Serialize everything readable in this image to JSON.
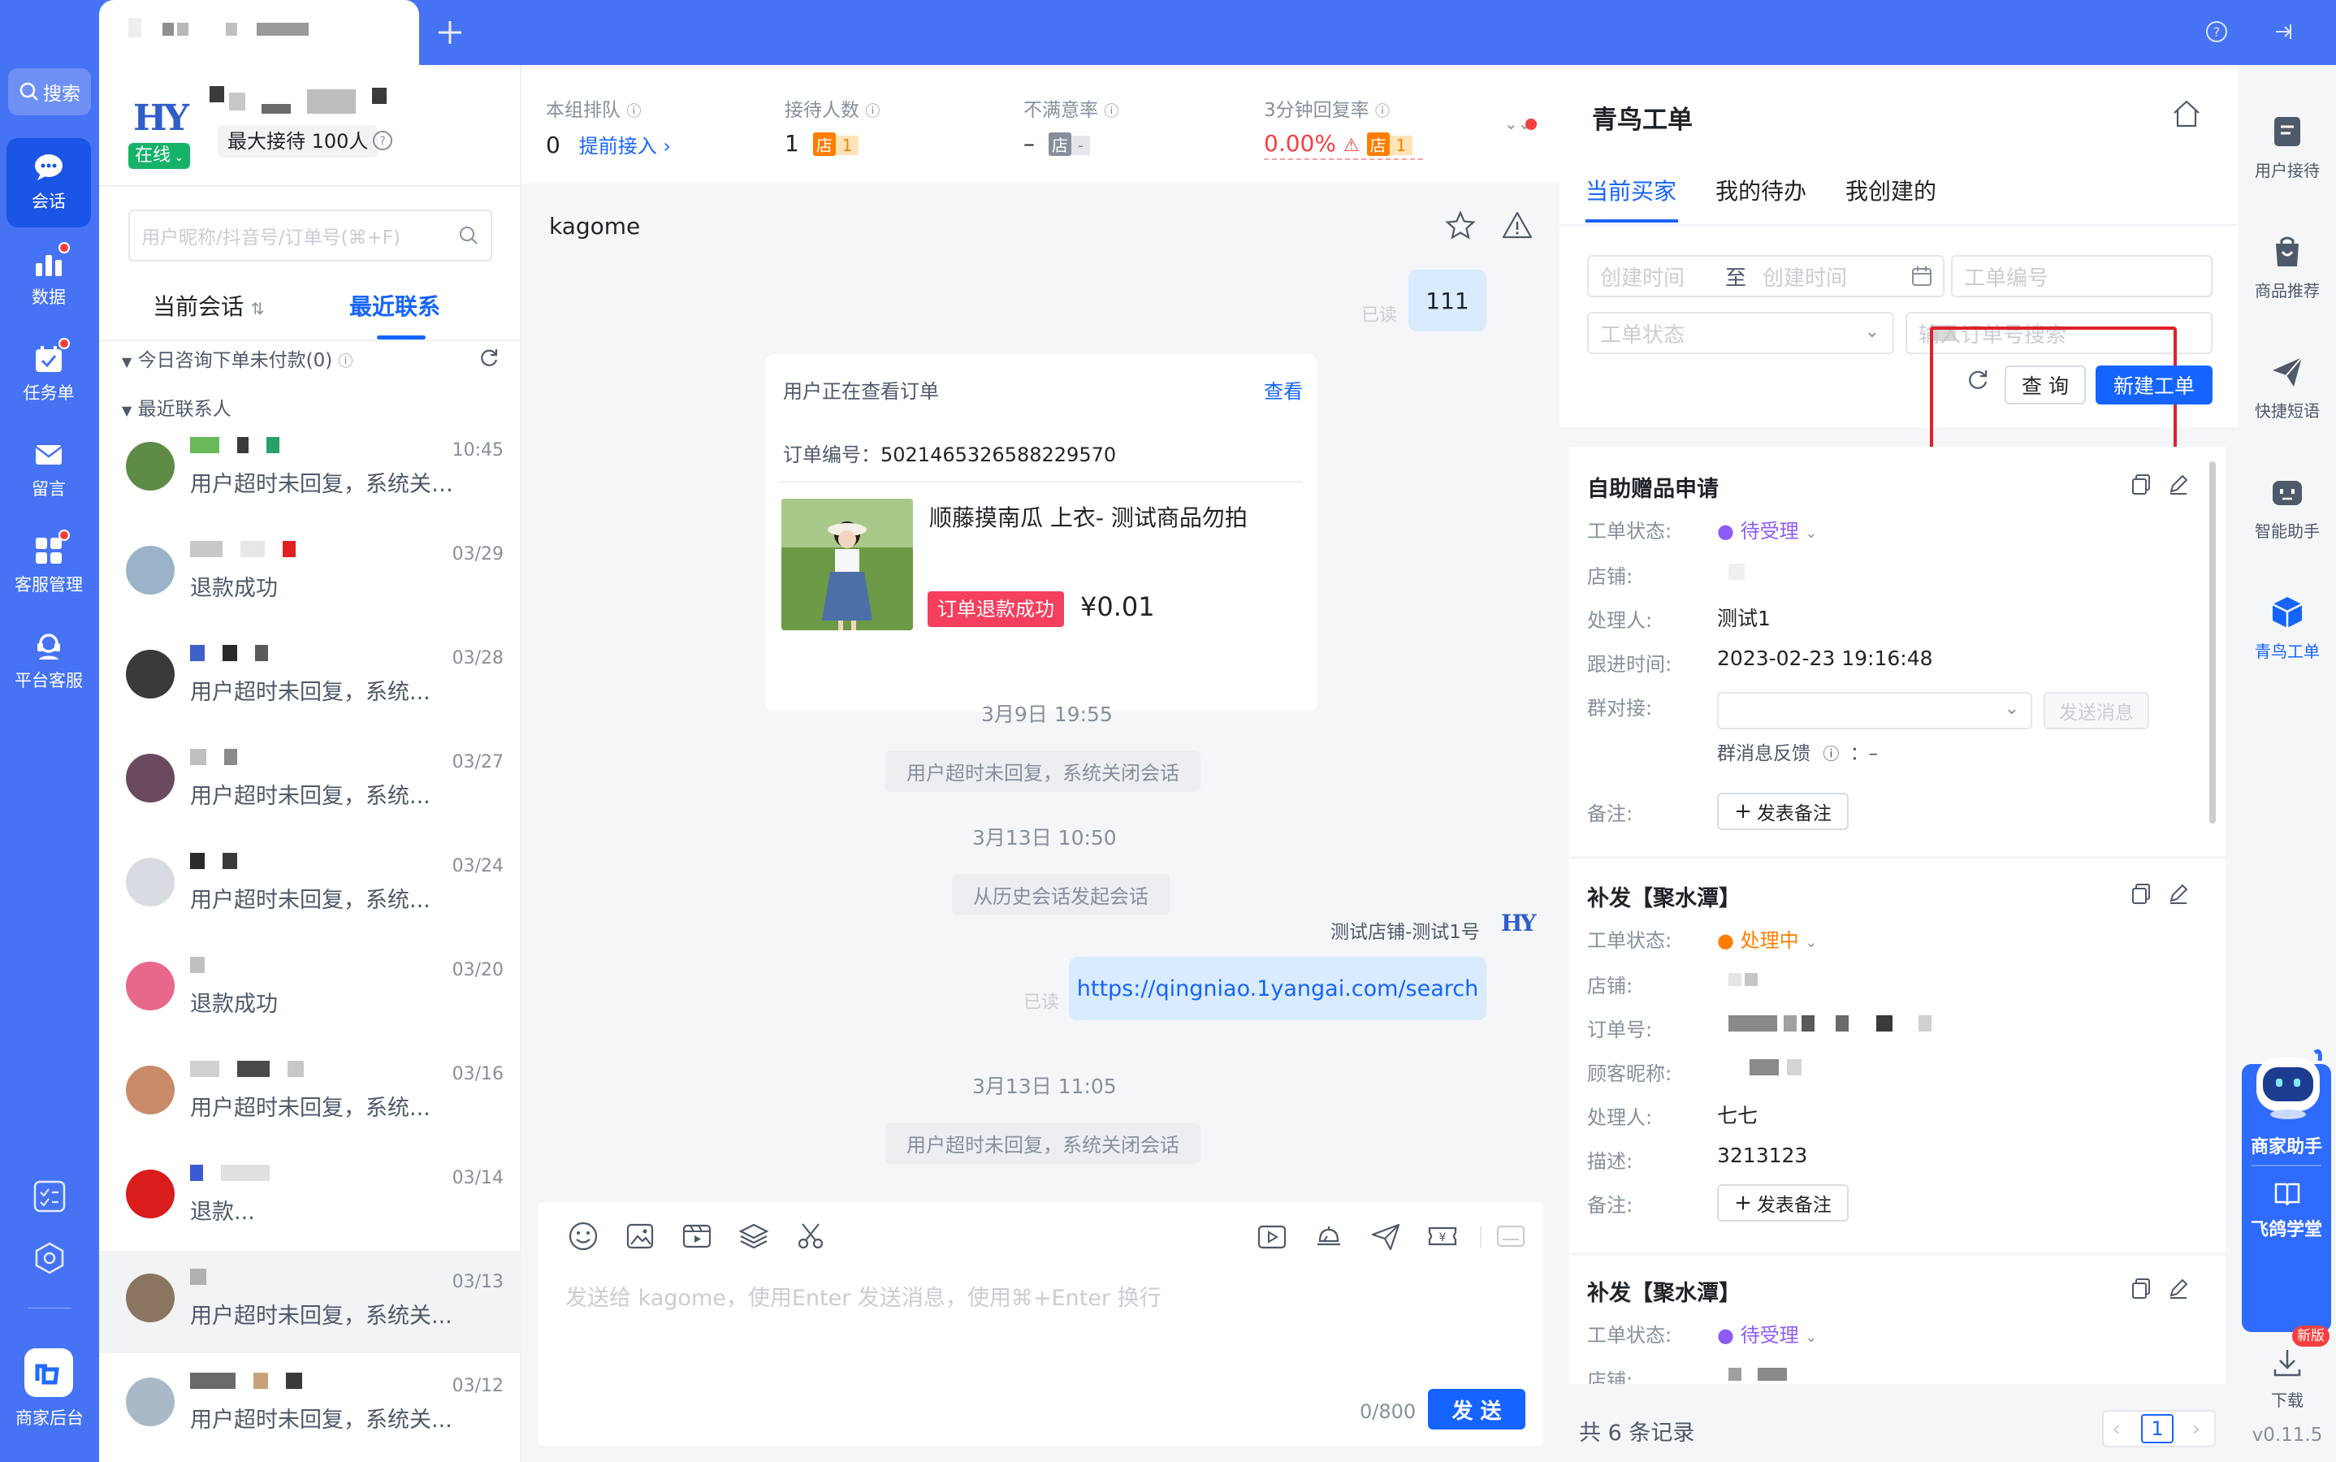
{
  "search": {
    "label": "搜索"
  },
  "nav": [
    {
      "label": "会话",
      "icon": "chat-icon",
      "active": true
    },
    {
      "label": "数据",
      "icon": "chart-icon",
      "badge": true
    },
    {
      "label": "任务单",
      "icon": "calendar-check-icon",
      "badge": true
    },
    {
      "label": "留言",
      "icon": "mail-icon"
    },
    {
      "label": "客服管理",
      "icon": "grid-icon",
      "badge": true
    },
    {
      "label": "平台客服",
      "icon": "headset-icon"
    }
  ],
  "nav_bottom": {
    "backend_label": "商家后台"
  },
  "agent": {
    "status": "在线",
    "max_receive": "最大接待 100人",
    "logo_text": "HY"
  },
  "contact_search": {
    "placeholder": "用户昵称/抖音号/订单号(⌘+F)"
  },
  "contact_tabs": {
    "current": "当前会话",
    "recent": "最近联系"
  },
  "sections": {
    "today_unpaid": "今日咨询下单未付款(0)",
    "recent_contacts": "最近联系人"
  },
  "contacts": [
    {
      "time": "10:45",
      "preview": "用户超时未回复，系统关…",
      "avatar_color": "#5e8c47"
    },
    {
      "time": "03/29",
      "preview": "退款成功",
      "avatar_color": "#9bb3c9"
    },
    {
      "time": "03/28",
      "preview": "用户超时未回复，系统...",
      "avatar_color": "#3a3a3a"
    },
    {
      "time": "03/27",
      "preview": "用户超时未回复，系统...",
      "avatar_color": "#6b4a5f"
    },
    {
      "time": "03/24",
      "preview": "用户超时未回复，系统...",
      "avatar_color": "#d8dce2"
    },
    {
      "time": "03/20",
      "preview": "退款成功",
      "avatar_color": "#e8688b"
    },
    {
      "time": "03/16",
      "preview": "用户超时未回复，系统...",
      "avatar_color": "#c98a6a"
    },
    {
      "time": "03/14",
      "preview": "退款...",
      "avatar_color": "#d91c1c"
    },
    {
      "time": "03/13",
      "preview": "用户超时未回复，系统关...",
      "avatar_color": "#8a7560"
    },
    {
      "time": "03/12",
      "preview": "用户超时未回复，系统关...",
      "avatar_color": "#a9b9c8"
    }
  ],
  "stats": [
    {
      "label": "本组排队",
      "value": "0",
      "link": "提前接入"
    },
    {
      "label": "接待人数",
      "value": "1",
      "shop_count": "1"
    },
    {
      "label": "不满意率",
      "value": "–",
      "shop_count": "-"
    },
    {
      "label": "3分钟回复率",
      "value": "0.00%",
      "shop_count": "1"
    }
  ],
  "chat": {
    "customer_name": "kagome",
    "msg1": "111",
    "read1": "已读",
    "order_card": {
      "title": "用户正在查看订单",
      "view_link": "查看",
      "order_label": "订单编号：",
      "order_no": "5021465326588229570",
      "product_name": "顺藤摸南瓜 上衣- 测试商品勿拍",
      "status_tag": "订单退款成功",
      "price": "¥0.01"
    },
    "time1": "3月9日 19:55",
    "sys1": "用户超时未回复，系统关闭会话",
    "time2": "3月13日 10:50",
    "sys2": "从历史会话发起会话",
    "agent_name": "测试店铺-测试1号",
    "msg2": "https://qingniao.1yangai.com/search",
    "read2": "已读",
    "time3": "3月13日 11:05",
    "sys3": "用户超时未回复，系统关闭会话"
  },
  "composer": {
    "placeholder": "发送给 kagome，使用Enter 发送消息，使用⌘+Enter 换行",
    "counter": "0/800",
    "send_label": "发 送"
  },
  "workorder": {
    "title": "青鸟工单",
    "tabs": [
      "当前买家",
      "我的待办",
      "我创建的"
    ],
    "filters": {
      "create_time_start": "创建时间",
      "to": "至",
      "create_time_end": "创建时间",
      "order_no": "工单编号",
      "status": "工单状态",
      "search_order": "输入订单号搜索"
    },
    "query_label": "查 询",
    "new_label": "新建工单",
    "cards": [
      {
        "title": "自助赠品申请",
        "status_label": "工单状态:",
        "status": "待受理",
        "status_color": "#8d5cf6",
        "shop_label": "店铺:",
        "handler_label": "处理人:",
        "handler": "测试1",
        "followup_label": "跟进时间:",
        "followup": "2023-02-23 19:16:48",
        "group_label": "群对接:",
        "send_msg": "发送消息",
        "group_feedback": "群消息反馈",
        "group_feedback_value": "：–",
        "remark_label": "备注:",
        "add_remark": "发表备注"
      },
      {
        "title": "补发【聚水潭】",
        "status_label": "工单状态:",
        "status": "处理中",
        "status_color": "#ff7d00",
        "shop_label": "店铺:",
        "order_label": "订单号:",
        "nick_label": "顾客昵称:",
        "handler_label": "处理人:",
        "handler": "七七",
        "desc_label": "描述:",
        "desc": "3213123",
        "remark_label": "备注:",
        "add_remark": "发表备注"
      },
      {
        "title": "补发【聚水潭】",
        "status_label": "工单状态:",
        "status": "待受理",
        "status_color": "#8d5cf6",
        "shop_label": "店铺:"
      }
    ],
    "total": "共 6 条记录",
    "page": "1"
  },
  "rail": [
    {
      "label": "用户接待",
      "icon": "user-reception-icon"
    },
    {
      "label": "商品推荐",
      "icon": "shopping-bag-icon"
    },
    {
      "label": "快捷短语",
      "icon": "paper-plane-icon"
    },
    {
      "label": "智能助手",
      "icon": "robot-icon"
    },
    {
      "label": "青鸟工单",
      "icon": "cube-icon",
      "active": true
    }
  ],
  "assistant": {
    "label": "商家助手",
    "academy": "飞鸽学堂"
  },
  "download": {
    "badge": "新版",
    "label": "下载",
    "version": "v0.11.5"
  },
  "colors": {
    "brand": "#4673f3",
    "primary": "#1664ff",
    "danger": "#f53f3f"
  }
}
